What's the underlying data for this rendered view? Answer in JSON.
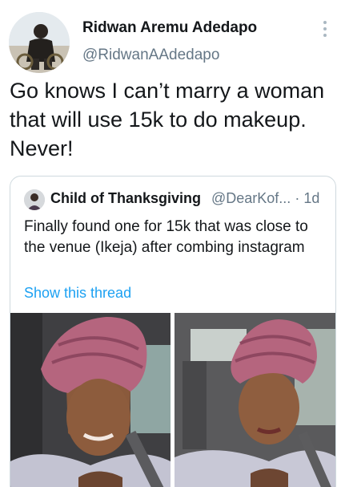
{
  "tweet": {
    "author_name": "Ridwan Aremu Adedapo",
    "author_handle": "@RidwanAAdedapo",
    "text": "Go knows I can’t marry a woman that will use 15k to do makeup. Never!",
    "more_icon": "more-vertical-icon"
  },
  "quote": {
    "author_name": "Child of Thanksgiving",
    "author_handle": "@DearKof...",
    "time": "1d",
    "separator": "·",
    "text": "Finally found one for 15k that was close to the venue (Ikeja) after combing instagram",
    "thread_link": "Show this thread",
    "link_color": "#1da1f2"
  },
  "colors": {
    "text": "#14171a",
    "secondary": "#657786",
    "border": "#cfd9de",
    "gele": "#b5657e"
  }
}
